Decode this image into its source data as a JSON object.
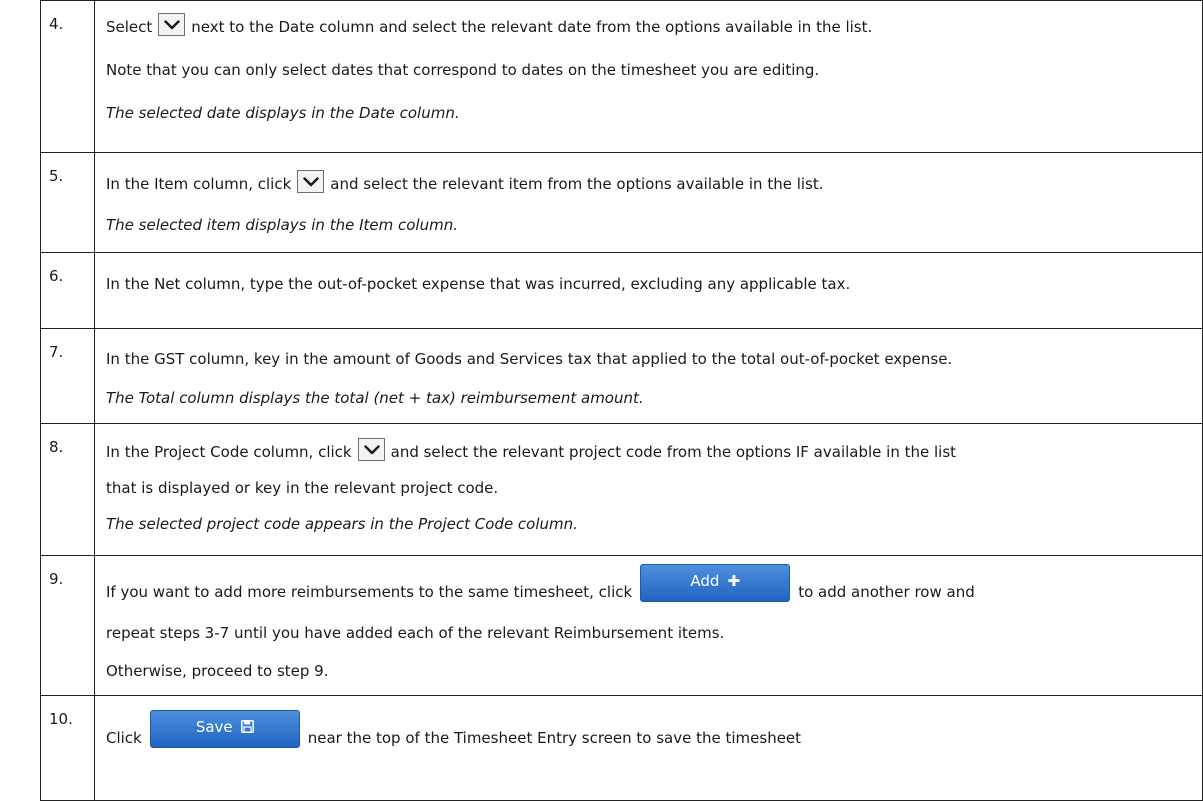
{
  "steps": [
    {
      "number": "4.",
      "line1_before": "Select",
      "line1_after": "next to the Date column and select the relevant date from the options available in the list.",
      "line2": "Note that you can only select dates that correspond to dates on the timesheet you are editing.",
      "result": "The selected date displays in the Date column."
    },
    {
      "number": "5.",
      "line1_before": "In the Item column, click",
      "line1_after": "and select the relevant item from the options available in the list.",
      "result": "The selected item displays in the Item column."
    },
    {
      "number": "6.",
      "line1": "In the Net column, type the out-of-pocket expense that was incurred, excluding any applicable tax."
    },
    {
      "number": "7.",
      "line1": "In the GST column, key in the amount of Goods and Services tax that applied to the total out-of-pocket expense.",
      "result": "The Total column displays the total (net + tax) reimbursement amount."
    },
    {
      "number": "8.",
      "line1_before": "In the Project Code column, click",
      "line1_after": "and select the relevant project code from the options IF available in the list",
      "line2": "that is displayed or key in the relevant project code.",
      "result": "The selected project code appears in the Project Code column."
    },
    {
      "number": "9.",
      "line1_before": "If you want to add more reimbursements to the same timesheet, click",
      "line1_after": "to add another row and",
      "line2": "repeat steps 3-7 until you have added each of the relevant Reimbursement items.",
      "line3": "Otherwise, proceed to step 9."
    },
    {
      "number": "10.",
      "line1_before": "Click",
      "line1_after": "near the top of the Timesheet Entry screen to save the timesheet"
    }
  ],
  "buttons": {
    "add_label": "Add",
    "add_icon": "plus-icon",
    "save_label": "Save",
    "save_icon": "floppy-disk-icon"
  },
  "colors": {
    "button_blue": "#2f72cf",
    "dropdown_border": "#6f6f6f",
    "table_border": "#222222"
  }
}
